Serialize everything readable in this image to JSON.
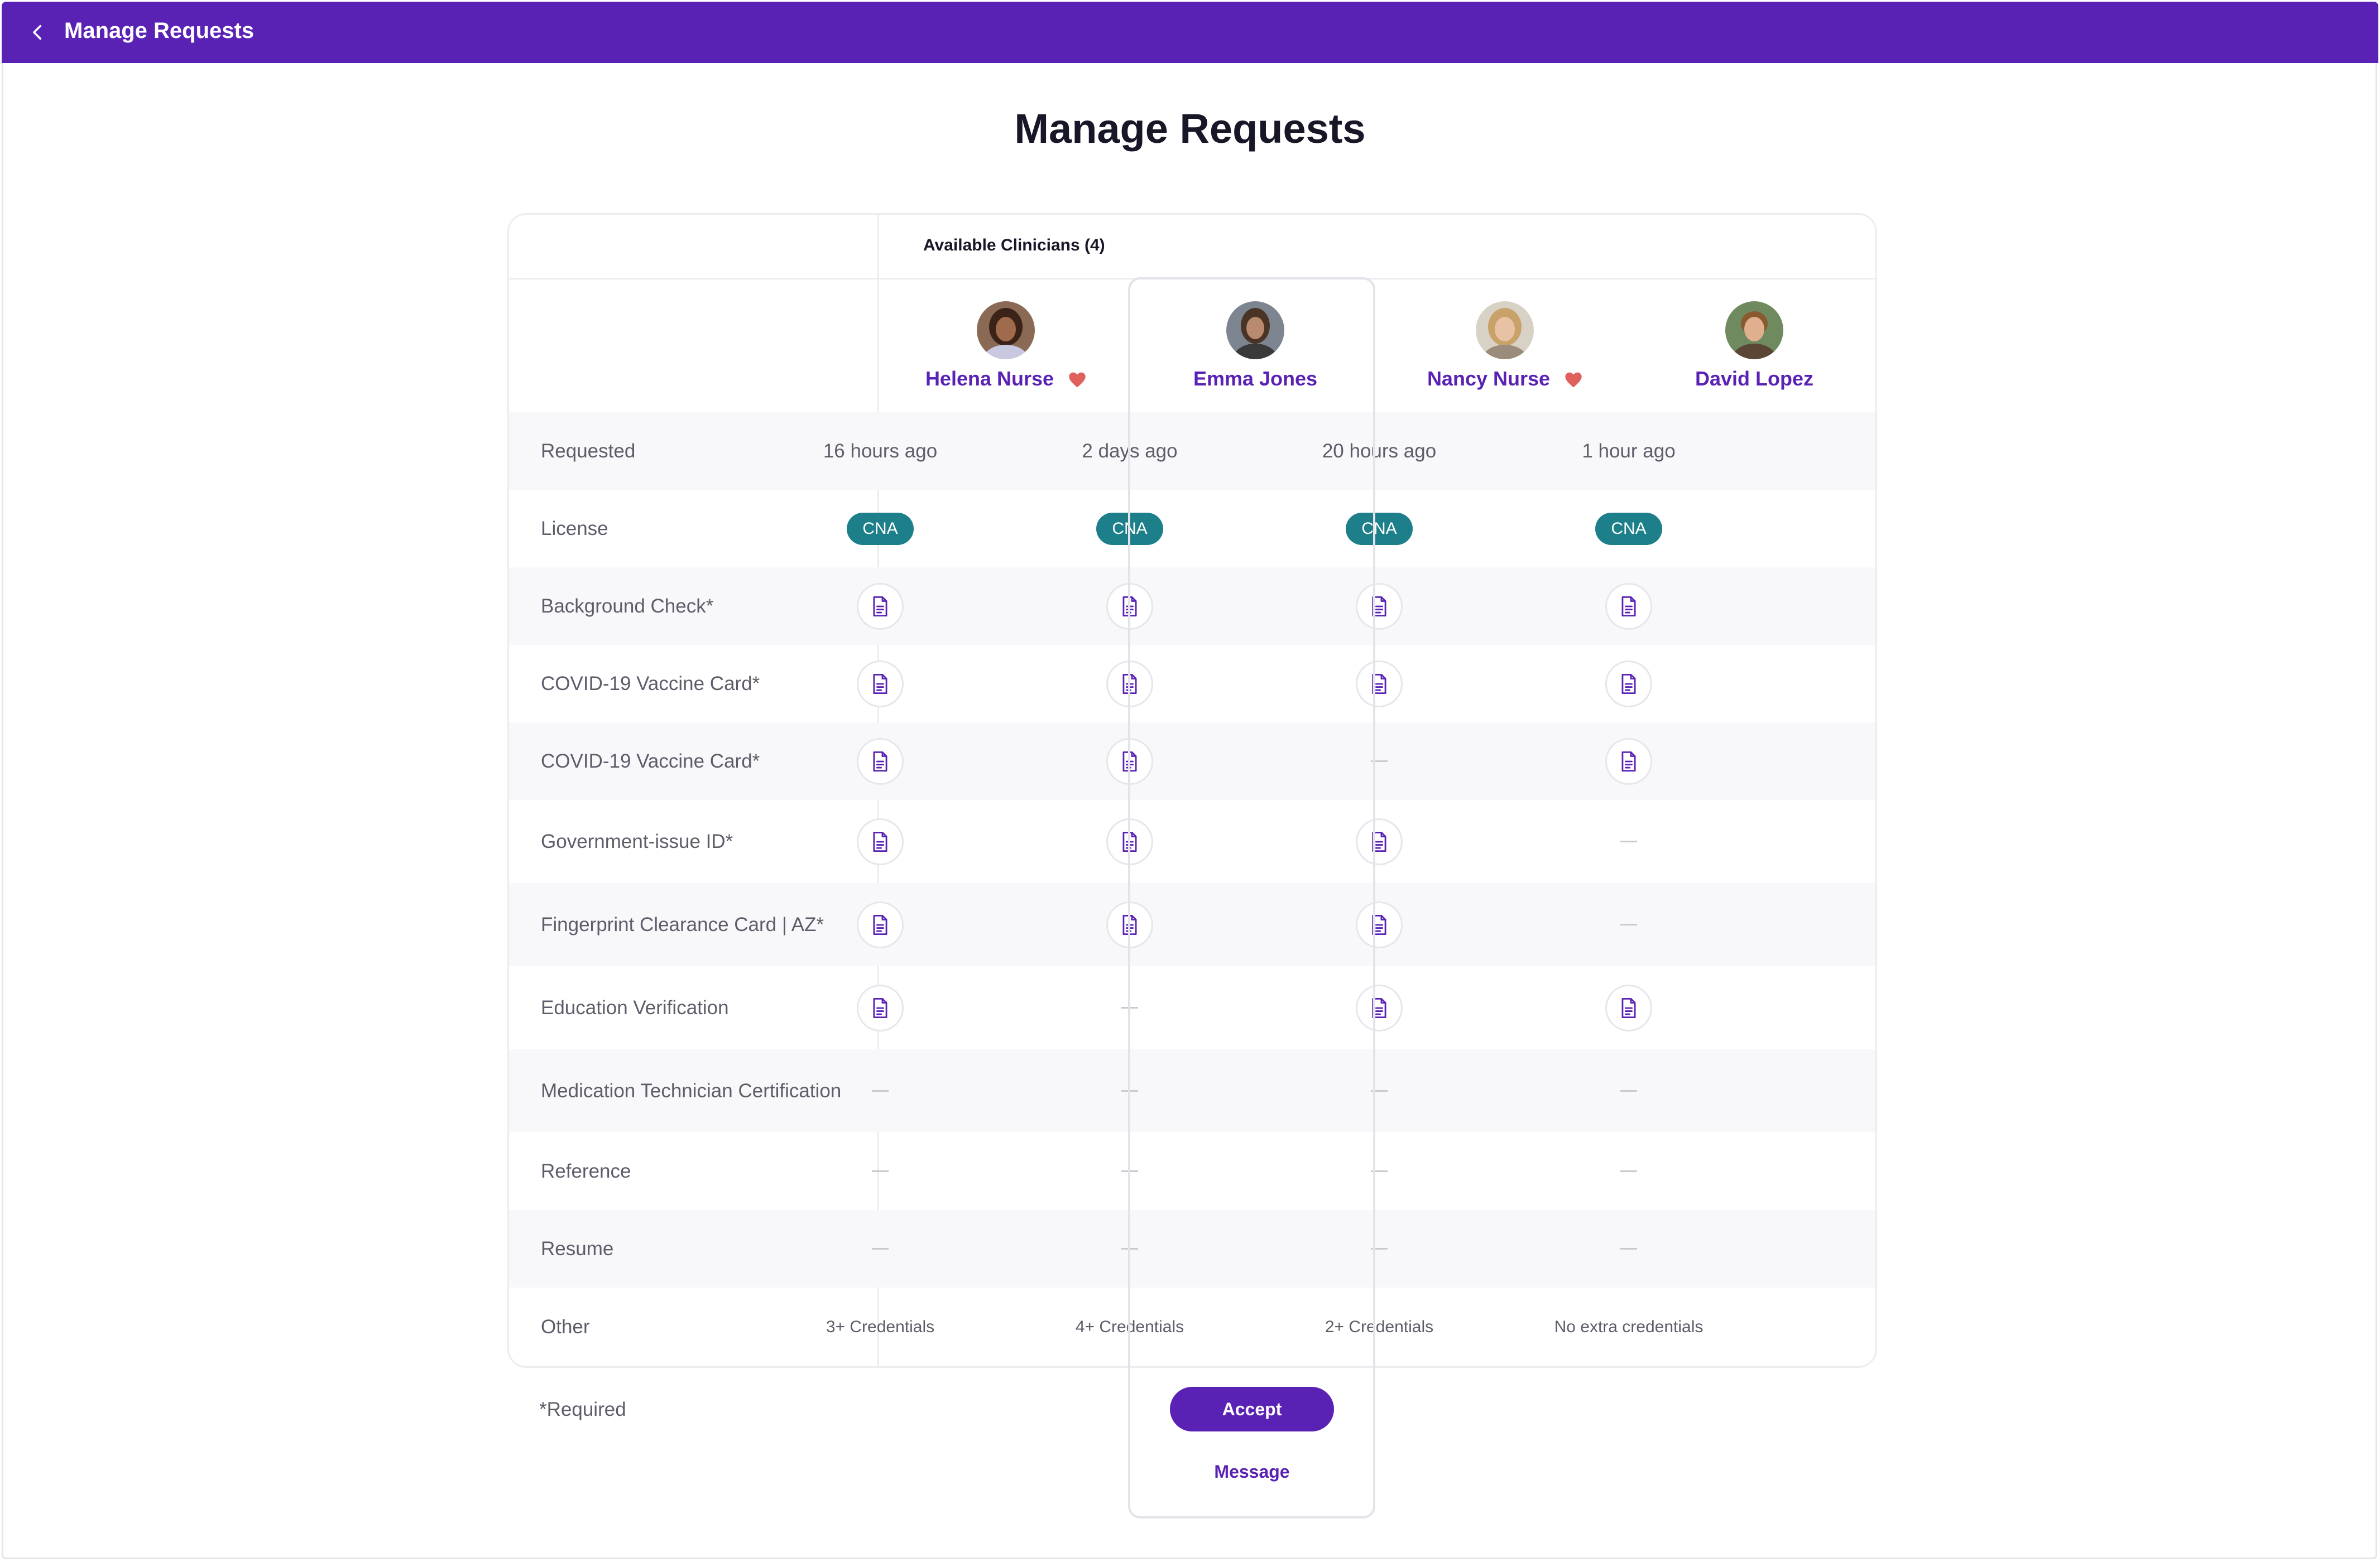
{
  "topbar": {
    "title": "Manage Requests",
    "back_icon": "chevron-left-icon"
  },
  "page": {
    "title": "Manage Requests"
  },
  "table": {
    "available_label": "Available Clinicians (4)",
    "clinicians": [
      {
        "name": "Helena Nurse",
        "favorite": true
      },
      {
        "name": "Emma Jones",
        "favorite": false
      },
      {
        "name": "Nancy Nurse",
        "favorite": true
      },
      {
        "name": "David Lopez",
        "favorite": false
      }
    ],
    "rows": [
      {
        "label": "Requested",
        "type": "text",
        "values": [
          "16 hours ago",
          "2 days ago",
          "20 hours ago",
          "1 hour ago"
        ]
      },
      {
        "label": "License",
        "type": "badge",
        "values": [
          "CNA",
          "CNA",
          "CNA",
          "CNA"
        ]
      },
      {
        "label": "Background Check*",
        "type": "doc",
        "values": [
          true,
          true,
          true,
          true
        ]
      },
      {
        "label": "COVID-19 Vaccine Card*",
        "type": "doc",
        "values": [
          true,
          true,
          true,
          true
        ]
      },
      {
        "label": "COVID-19 Vaccine Card*",
        "type": "doc",
        "values": [
          true,
          true,
          false,
          true
        ]
      },
      {
        "label": "Government-issue ID*",
        "type": "doc",
        "values": [
          true,
          true,
          true,
          false
        ]
      },
      {
        "label": "Fingerprint Clearance Card | AZ*",
        "type": "doc",
        "values": [
          true,
          true,
          true,
          false
        ]
      },
      {
        "label": "Education Verification",
        "type": "doc",
        "values": [
          true,
          false,
          true,
          true
        ]
      },
      {
        "label": "Medication Technician Certification",
        "type": "doc",
        "values": [
          false,
          false,
          false,
          false
        ]
      },
      {
        "label": "Reference",
        "type": "doc",
        "values": [
          false,
          false,
          false,
          false
        ]
      },
      {
        "label": "Resume",
        "type": "doc",
        "values": [
          false,
          false,
          false,
          false
        ]
      },
      {
        "label": "Other",
        "type": "small",
        "values": [
          "3+ Credentials",
          "4+ Credentials",
          "2+ Credentials",
          "No extra credentials"
        ]
      }
    ]
  },
  "footer": {
    "required_note": "*Required",
    "accept_label": "Accept",
    "message_label": "Message"
  },
  "colors": {
    "brand": "#5a22b4",
    "badge": "#1c7f8a",
    "heart": "#e0605e"
  }
}
